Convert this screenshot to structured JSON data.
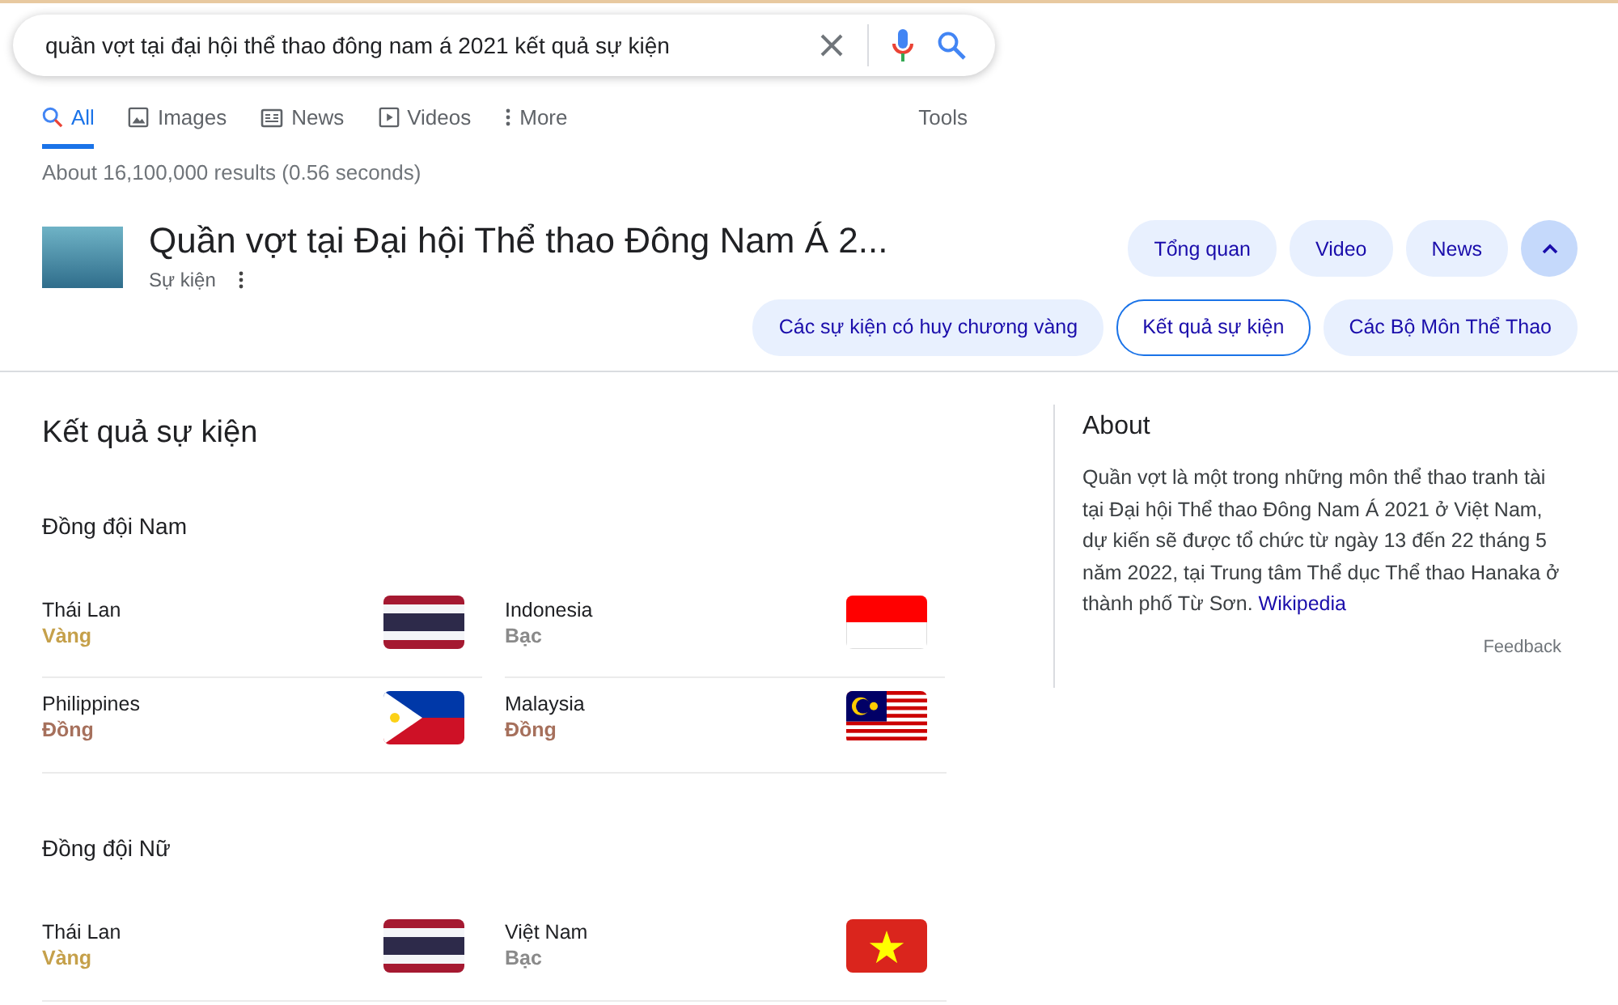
{
  "search": {
    "value": "quần vợt tại đại hội thể thao đông nam á 2021 kết quả sự kiện"
  },
  "tabs": [
    {
      "label": "All",
      "kind": "all",
      "selected": true
    },
    {
      "label": "Images",
      "kind": "images",
      "selected": false
    },
    {
      "label": "News",
      "kind": "news",
      "selected": false
    },
    {
      "label": "Videos",
      "kind": "videos",
      "selected": false
    },
    {
      "label": "More",
      "kind": "more",
      "selected": false
    }
  ],
  "tools": "Tools",
  "result_stats": "About 16,100,000 results (0.56 seconds)",
  "entity": {
    "title": "Quần vợt tại Đại hội Thể thao Đông Nam Á 2...",
    "subtitle": "Sự kiện"
  },
  "chips_top": [
    {
      "label": "Tổng quan",
      "selected": false
    },
    {
      "label": "Video",
      "selected": false
    },
    {
      "label": "News",
      "selected": false
    }
  ],
  "chips_bottom": [
    {
      "label": "Các sự kiện có huy chương vàng",
      "selected": false
    },
    {
      "label": "Kết quả sự kiện",
      "selected": true
    },
    {
      "label": "Các Bộ Môn Thể Thao",
      "selected": false
    }
  ],
  "results": {
    "heading": "Kết quả sự kiện",
    "groups": [
      {
        "name": "Đồng đội Nam",
        "entries": [
          {
            "country": "Thái Lan",
            "medal": "Vàng",
            "color": "#c5a04a",
            "kind": "thailand"
          },
          {
            "country": "Indonesia",
            "medal": "Bạc",
            "color": "#8a8a8a",
            "kind": "indonesia"
          },
          {
            "country": "Philippines",
            "medal": "Đồng",
            "color": "#a6705c",
            "kind": "philippines"
          },
          {
            "country": "Malaysia",
            "medal": "Đồng",
            "color": "#a6705c",
            "kind": "malaysia"
          }
        ]
      },
      {
        "name": "Đồng đội Nữ",
        "entries": [
          {
            "country": "Thái Lan",
            "medal": "Vàng",
            "color": "#c5a04a",
            "kind": "thailand"
          },
          {
            "country": "Việt Nam",
            "medal": "Bạc",
            "color": "#8a8a8a",
            "kind": "vietnam"
          }
        ]
      }
    ]
  },
  "about": {
    "heading": "About",
    "text": "Quần vợt là một trong những môn thể thao tranh tài tại Đại hội Thể thao Đông Nam Á 2021 ở Việt Nam, dự kiến sẽ được tổ chức từ ngày 13 đến 22 tháng 5 năm 2022, tại Trung tâm Thể dục Thể thao Hanaka ở thành phố Từ Sơn.",
    "link": "Wikipedia",
    "feedback": "Feedback"
  }
}
